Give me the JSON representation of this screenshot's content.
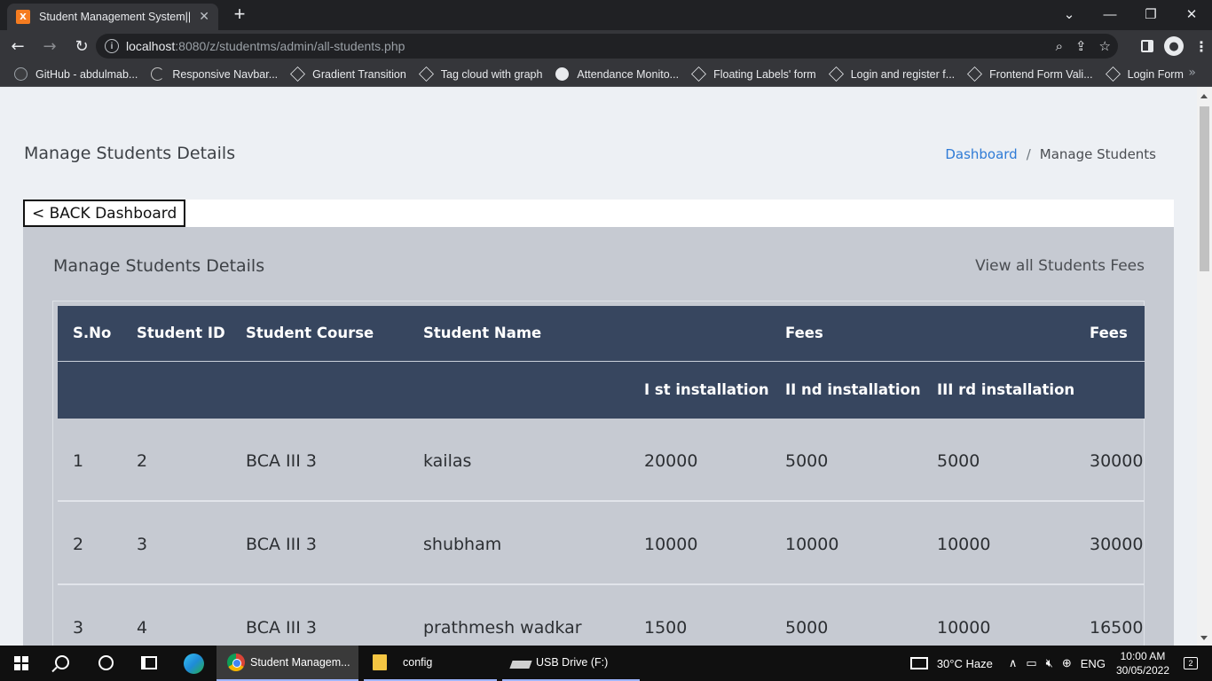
{
  "browser": {
    "tab_title": "Student Management System|||M",
    "tab_favicon_letter": "X",
    "url_host": "localhost",
    "url_rest": ":8080/z/studentms/admin/all-students.php",
    "bookmarks": [
      {
        "label": "GitHub - abdulmab...",
        "icon": "github-icon"
      },
      {
        "label": "Responsive Navbar...",
        "icon": "swirl-icon"
      },
      {
        "label": "Gradient Transition",
        "icon": "codepen-icon"
      },
      {
        "label": "Tag cloud with graph",
        "icon": "codepen-icon"
      },
      {
        "label": "Attendance Monito...",
        "icon": "globe-icon"
      },
      {
        "label": "Floating Labels' form",
        "icon": "codepen-icon"
      },
      {
        "label": "Login and register f...",
        "icon": "codepen-icon"
      },
      {
        "label": "Frontend Form Vali...",
        "icon": "codepen-icon"
      },
      {
        "label": "Login Form",
        "icon": "codepen-icon"
      }
    ]
  },
  "page": {
    "title": "Manage Students Details",
    "breadcrumb": {
      "home": "Dashboard",
      "separator": "/",
      "current": "Manage Students"
    },
    "back_button": "< BACK Dashboard",
    "card_title": "Manage Students Details",
    "card_link": "View all Students Fees"
  },
  "table": {
    "headers_row1": {
      "sno": "S.No",
      "student_id": "Student ID",
      "course": "Student Course",
      "name": "Student Name",
      "fees_group": "Fees",
      "fees_total": "Fees"
    },
    "headers_row2": {
      "inst1": "I st installation",
      "inst2": "II nd installation",
      "inst3": "III rd installation"
    },
    "rows": [
      {
        "sno": "1",
        "id": "2",
        "course": "BCA III 3",
        "name": "kailas",
        "inst1": "20000",
        "inst2": "5000",
        "inst3": "5000",
        "total": "30000"
      },
      {
        "sno": "2",
        "id": "3",
        "course": "BCA III 3",
        "name": "shubham",
        "inst1": "10000",
        "inst2": "10000",
        "inst3": "10000",
        "total": "30000"
      },
      {
        "sno": "3",
        "id": "4",
        "course": "BCA III 3",
        "name": "prathmesh wadkar",
        "inst1": "1500",
        "inst2": "5000",
        "inst3": "10000",
        "total": "16500"
      }
    ]
  },
  "taskbar": {
    "chrome_label": "Student Managem...",
    "folder_label": "config",
    "usb_label": "USB Drive (F:)",
    "weather": "30°C  Haze",
    "lang": "ENG",
    "time": "10:00 AM",
    "date": "30/05/2022",
    "notification_count": "2"
  }
}
